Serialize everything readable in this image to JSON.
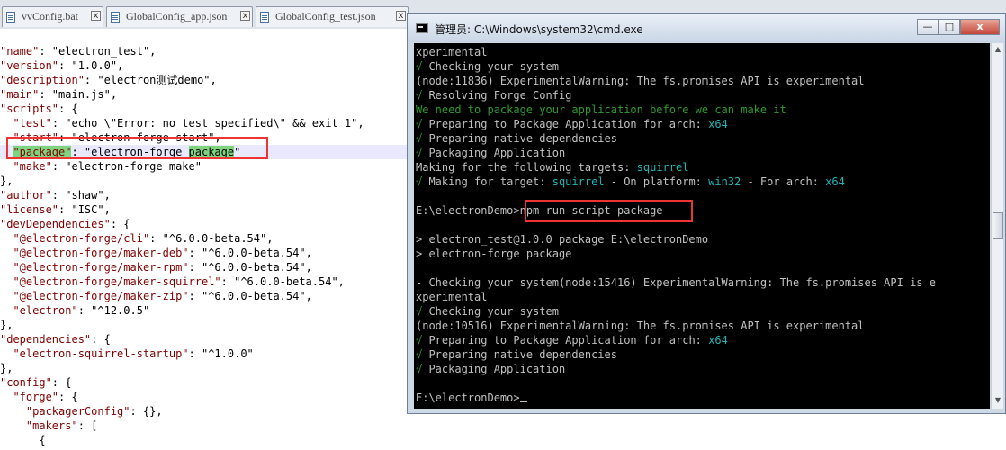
{
  "editor_tabs": [
    {
      "label": "vvConfig.bat",
      "close": "x"
    },
    {
      "label": "GlobalConfig_app.json",
      "close": "x"
    },
    {
      "label": "GlobalConfig_test.json",
      "close": "x"
    }
  ],
  "code": {
    "l1_key": "\"name\"",
    "l1_val": ": \"electron_test\",",
    "l2_key": "\"version\"",
    "l2_val": ": \"1.0.0\",",
    "l3_key": "\"description\"",
    "l3_val": ": \"electron测试demo\",",
    "l4_key": "\"main\"",
    "l4_val": ": \"main.js\",",
    "l5_key": "\"scripts\"",
    "l5_val": ": {",
    "l6_indent": "  ",
    "l6_key": "\"test\"",
    "l6_val": ": \"echo \\\"Error: no test specified\\\" && exit 1\",",
    "l7_indent": "  ",
    "l7_key": "\"start\"",
    "l7_val": ": \"electron-forge start\",",
    "l8_indent": "  ",
    "l8_key": "\"package\"",
    "l8_val_a": ": \"electron-forge ",
    "l8_val_hl": "package",
    "l8_val_b": "\"",
    "l9_indent": "  ",
    "l9_key": "\"make\"",
    "l9_val": ": \"electron-forge make\"",
    "l10": "},",
    "l11_key": "\"author\"",
    "l11_val": ": \"shaw\",",
    "l12_key": "\"license\"",
    "l12_val": ": \"ISC\",",
    "l13_key": "\"devDependencies\"",
    "l13_val": ": {",
    "l14_indent": "  ",
    "l14_key": "\"@electron-forge/cli\"",
    "l14_val": ": \"^6.0.0-beta.54\",",
    "l15_indent": "  ",
    "l15_key": "\"@electron-forge/maker-deb\"",
    "l15_val": ": \"^6.0.0-beta.54\",",
    "l16_indent": "  ",
    "l16_key": "\"@electron-forge/maker-rpm\"",
    "l16_val": ": \"^6.0.0-beta.54\",",
    "l17_indent": "  ",
    "l17_key": "\"@electron-forge/maker-squirrel\"",
    "l17_val": ": \"^6.0.0-beta.54\",",
    "l18_indent": "  ",
    "l18_key": "\"@electron-forge/maker-zip\"",
    "l18_val": ": \"^6.0.0-beta.54\",",
    "l19_indent": "  ",
    "l19_key": "\"electron\"",
    "l19_val": ": \"^12.0.5\"",
    "l20": "},",
    "l21_key": "\"dependencies\"",
    "l21_val": ": {",
    "l22_indent": "  ",
    "l22_key": "\"electron-squirrel-startup\"",
    "l22_val": ": \"^1.0.0\"",
    "l23": "},",
    "l24_key": "\"config\"",
    "l24_val": ": {",
    "l25_indent": "  ",
    "l25_key": "\"forge\"",
    "l25_val": ": {",
    "l26_indent": "    ",
    "l26_key": "\"packagerConfig\"",
    "l26_val": ": {},",
    "l27_indent": "    ",
    "l27_key": "\"makers\"",
    "l27_val": ": [",
    "l28": "      {"
  },
  "cmd": {
    "title": "管理员: C:\\Windows\\system32\\cmd.exe",
    "minimize": "—",
    "maximize": "□",
    "close": "x",
    "c1": "xperimental",
    "c2_check": "√",
    "c2": " Checking your system",
    "c3": "(node:11836) ExperimentalWarning: The fs.promises API is experimental",
    "c4_check": "√",
    "c4": " Resolving Forge Config",
    "c5": "We need to package your application before we can make it",
    "c6_check": "√",
    "c6_a": " Preparing to Package Application for arch: ",
    "c6_b": "x64",
    "c7_check": "√",
    "c7": " Preparing native dependencies",
    "c8_check": "√",
    "c8": " Packaging Application",
    "c9_a": "Making for the following targets: ",
    "c9_b": "squirrel",
    "c10_check": "√",
    "c10_a": " Making for target: ",
    "c10_b": "squirrel",
    "c10_c": " - On platform: ",
    "c10_d": "win32",
    "c10_e": " - For arch: ",
    "c10_f": "x64",
    "c12_prompt": "E:\\electronDemo>",
    "c12_cmd": "npm run-script package",
    "c14": "> electron_test@1.0.0 package E:\\electronDemo",
    "c15": "> electron-forge package",
    "c17": "- Checking your system(node:15416) ExperimentalWarning: The fs.promises API is e",
    "c18": "xperimental",
    "c19_check": "√",
    "c19": " Checking your system",
    "c20": "(node:10516) ExperimentalWarning: The fs.promises API is experimental",
    "c21_check": "√",
    "c21_a": " Preparing to Package Application for arch: ",
    "c21_b": "x64",
    "c22_check": "√",
    "c22": " Preparing native dependencies",
    "c23_check": "√",
    "c23": " Packaging Application",
    "c25_prompt": "E:\\electronDemo>",
    "scroll_up": "▲",
    "scroll_down": "▼"
  },
  "colors": {
    "json_key": "#800000",
    "console_green": "#2e9c2e",
    "console_cyan": "#1fb5b5",
    "annotation": "#e33333",
    "package_highlight": "#7fd47f"
  }
}
